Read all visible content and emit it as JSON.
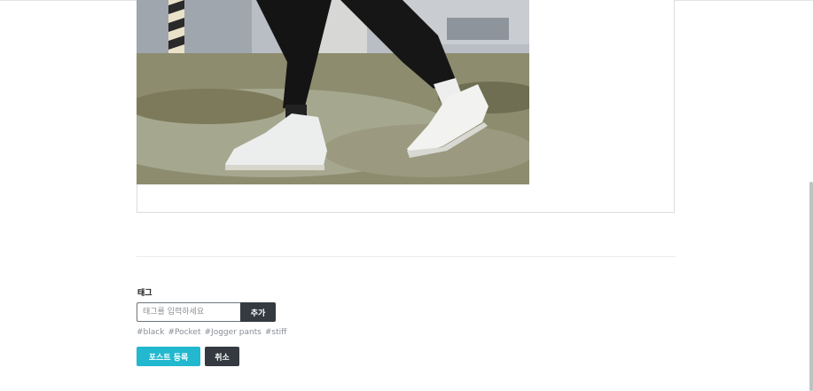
{
  "image": {
    "icon": "sneakers-photo",
    "alt": ""
  },
  "tag_section": {
    "title": "태그",
    "input_placeholder": "태그를 입력하세요",
    "input_value": "",
    "add_label": "추가",
    "tags": [
      "#black",
      "#Pocket",
      "#Jogger pants",
      "#stiff"
    ]
  },
  "actions": {
    "submit_label": "포스트 등록",
    "cancel_label": "취소"
  },
  "colors": {
    "submit": "#22b8cf",
    "dark": "#343a40",
    "tag_text": "#868e96"
  }
}
